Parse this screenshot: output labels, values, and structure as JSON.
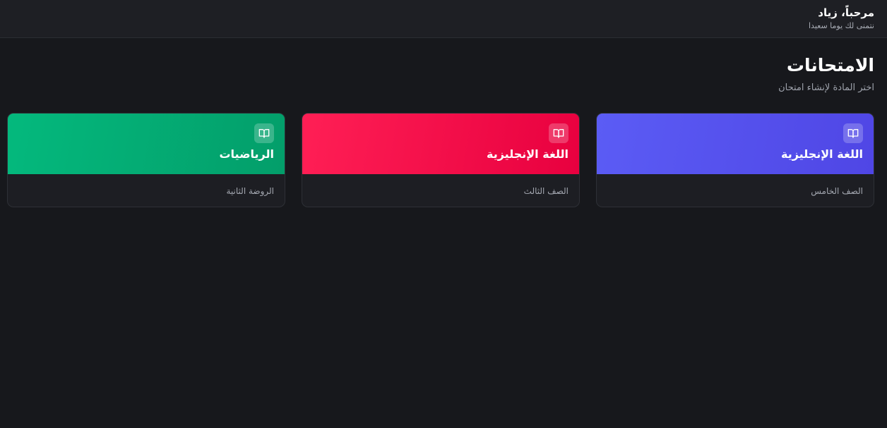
{
  "header": {
    "greeting": "مرحباً، زياد",
    "subtitle": "نتمنى لك يوما سعيدا"
  },
  "page": {
    "title": "الامتحانات",
    "subtitle": "اختر المادة لإنشاء امتحان"
  },
  "cards": [
    {
      "title": "اللغة الإنجليزية",
      "grade": "الصف الخامس",
      "icon": "book-open-icon",
      "color": "#5b5cf5"
    },
    {
      "title": "اللغة الإنجليزية",
      "grade": "الصف الثالث",
      "icon": "book-open-icon",
      "color": "#ff1f55"
    },
    {
      "title": "الرياضيات",
      "grade": "الروضة الثانية",
      "icon": "book-open-icon",
      "color": "#04b97d"
    }
  ]
}
